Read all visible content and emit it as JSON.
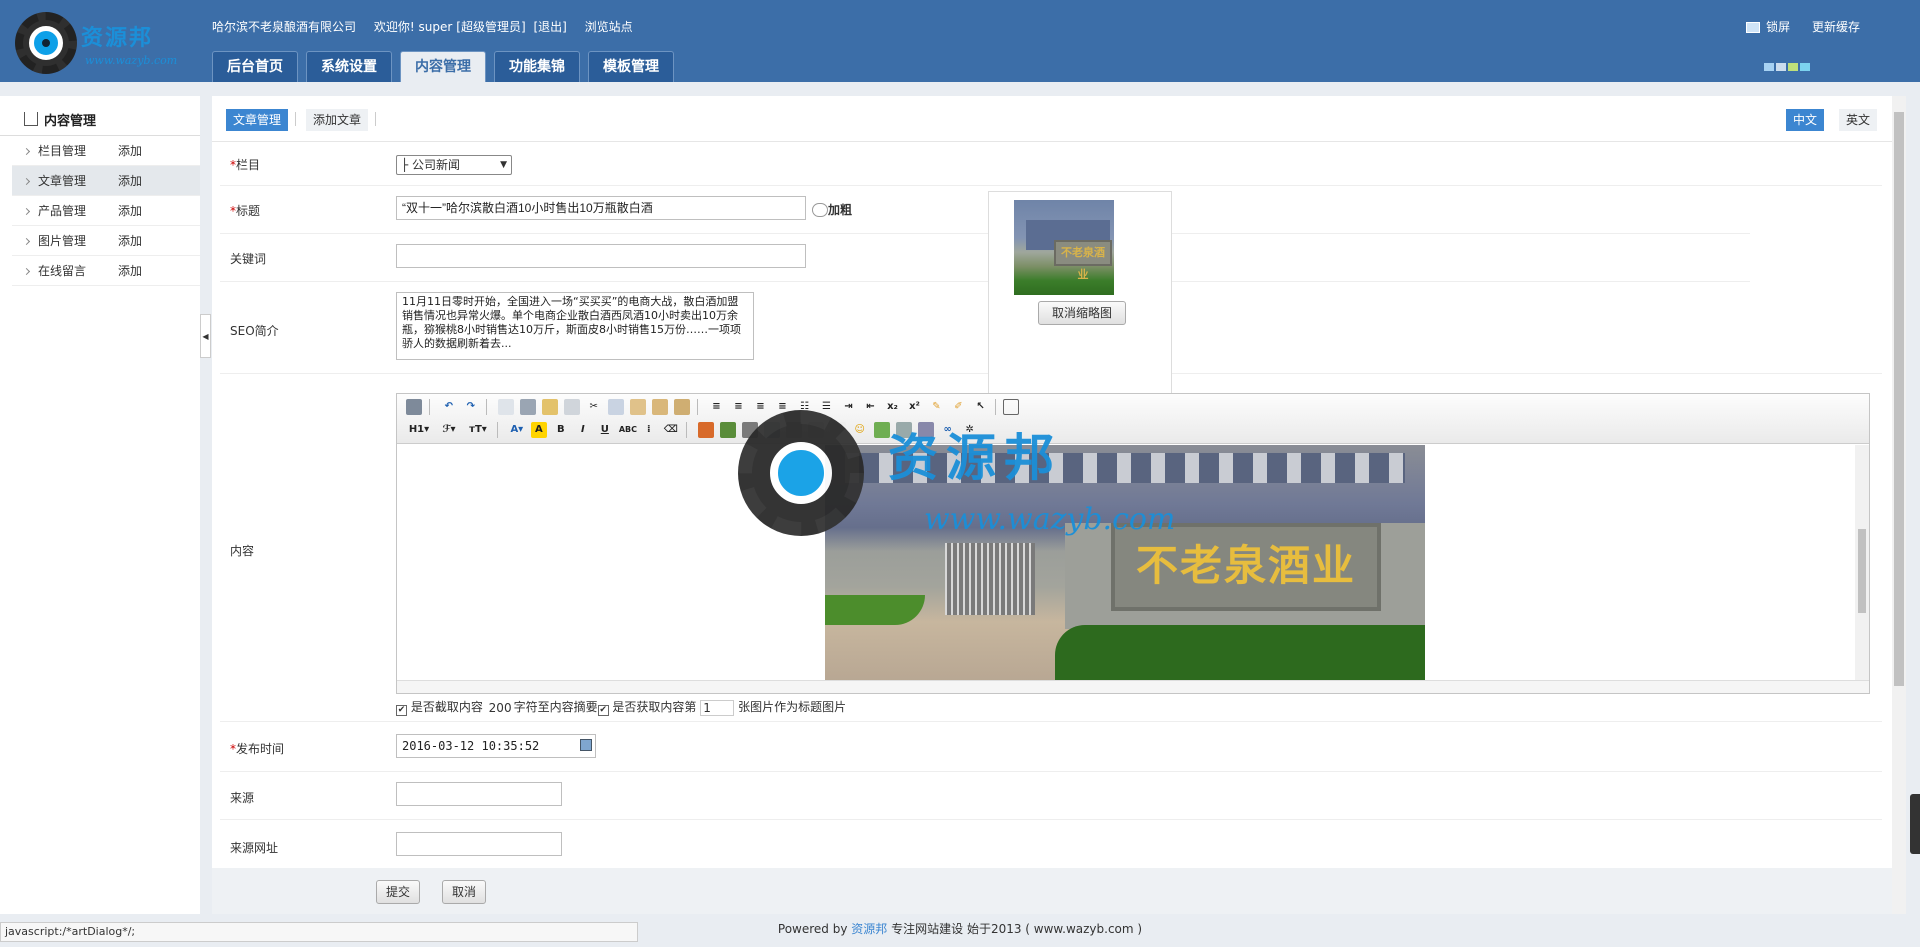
{
  "header": {
    "site_name": "哈尔滨不老泉酿酒有限公司",
    "welcome": "欢迎你! super",
    "role": "[超级管理员]",
    "logout": "[退出]",
    "browse": "浏览站点",
    "lock_screen": "锁屏",
    "update_cache": "更新缓存",
    "logo_text": "资源邦",
    "logo_url": "www.wazyb.com"
  },
  "nav": {
    "tabs": [
      "后台首页",
      "系统设置",
      "内容管理",
      "功能集锦",
      "模板管理"
    ],
    "active": 2
  },
  "sidebar": {
    "title": "内容管理",
    "items": [
      {
        "label": "栏目管理",
        "add": "添加"
      },
      {
        "label": "文章管理",
        "add": "添加"
      },
      {
        "label": "产品管理",
        "add": "添加"
      },
      {
        "label": "图片管理",
        "add": "添加"
      },
      {
        "label": "在线留言",
        "add": "添加"
      }
    ]
  },
  "subtabs": {
    "article_manage": "文章管理",
    "add_article": "添加文章",
    "lang_cn": "中文",
    "lang_en": "英文"
  },
  "form": {
    "column_label": "栏目",
    "column_value": "├ 公司新闻",
    "title_label": "标题",
    "title_value": "“双十一”哈尔滨散白酒10小时售出10万瓶散白酒",
    "bold_label": "加粗",
    "keywords_label": "关键词",
    "keywords_value": "",
    "seo_label": "SEO简介",
    "seo_value": "11月11日零时开始，全国进入一场“买买买”的电商大战，散白酒加盟销售情况也异常火爆。单个电商企业散白酒西凤酒10小时卖出10万余瓶，猕猴桃8小时销售达10万斤，斯面皮8小时销售15万份……一项项骄人的数据刷新着去...",
    "cancel_thumb": "取消缩略图",
    "thumb_sign": "不老泉酒业",
    "content_label": "内容",
    "content_sign": "不老泉酒业",
    "opt_extract": "是否截取内容",
    "opt_extract_num": "200",
    "opt_extract_suffix": "字符至内容摘要",
    "opt_fetch": "是否获取内容第",
    "opt_fetch_num": "1",
    "opt_fetch_suffix": "张图片作为标题图片",
    "pubtime_label": "发布时间",
    "pubtime_value": "2016-03-12 10:35:52",
    "source_label": "来源",
    "source_value": "",
    "source_url_label": "来源网址",
    "source_url_value": "",
    "submit": "提交",
    "cancel": "取消"
  },
  "editor": {
    "heading": "H1",
    "font": "ℱ",
    "size": "тT",
    "watermark_text": "资源邦",
    "watermark_url": "www.wazyb.com"
  },
  "footer": {
    "powered": "Powered by",
    "brand": "资源邦",
    "rest": "专注网站建设  始于2013 ( www.wazyb.com )"
  },
  "statusbar": "javascript:/*artDialog*/;",
  "colors": {
    "header_bg": "#3c6ea8",
    "accent": "#3c86d1",
    "required": "#cc0000"
  }
}
